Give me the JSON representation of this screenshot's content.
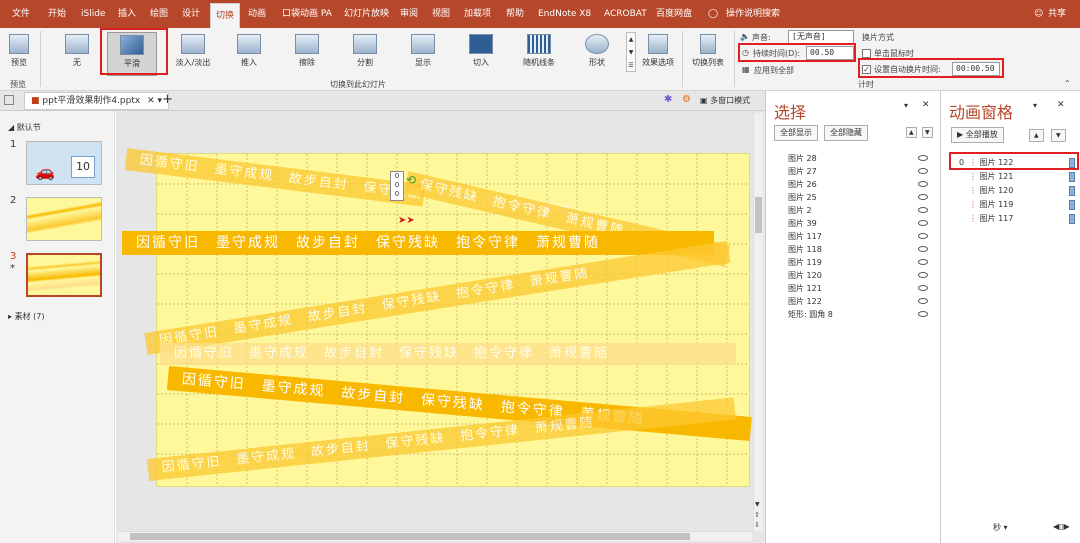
{
  "menu": {
    "items": [
      "文件",
      "开始",
      "iSlide",
      "插入",
      "绘图",
      "设计",
      "切换",
      "动画",
      "口袋动画 PA",
      "幻灯片放映",
      "审阅",
      "视图",
      "加载项",
      "帮助",
      "EndNote X8",
      "ACROBAT",
      "百度网盘"
    ],
    "active": "切换",
    "search": "操作说明搜索",
    "share": "共享"
  },
  "ribbon": {
    "preview_label": "预览",
    "preview_group": "预览",
    "transitions": [
      "无",
      "平滑",
      "淡入/淡出",
      "推入",
      "擦除",
      "分割",
      "显示",
      "切入",
      "随机线条",
      "形状"
    ],
    "selected_transition": "平滑",
    "effect_options": "效果选项",
    "group_label": "切换到此幻灯片",
    "switch_list": "切换列表",
    "sound_label": "声音:",
    "sound_value": "[无声音]",
    "duration_label": "持续时间(D):",
    "duration_value": "00.50",
    "apply_all": "应用到全部",
    "advance_title": "换片方式",
    "on_click": "单击鼠标时",
    "auto_advance": "设置自动换片时间:",
    "auto_value": "00:00.50",
    "timing_group": "计时"
  },
  "doc_tab": {
    "filename": "ppt平滑效果制作4.pptx",
    "multi_window": "多窗口模式"
  },
  "thumbs": {
    "section_default": "默认节",
    "section_material": "素材 (7)",
    "slide_numbers": [
      "1",
      "2",
      "3"
    ],
    "star": "*",
    "calendar_day": "10"
  },
  "slide": {
    "band_text": "因循守旧　墨守成规　故步自封　保守残缺　抱令守律　萧规曹随",
    "markers": [
      "0",
      "0",
      "0"
    ]
  },
  "colors": {
    "accent": "#b7472a",
    "band_dark": "#f9b800",
    "band_mid": "#fcc830",
    "band_light": "#fde08a"
  },
  "selection_pane": {
    "title": "选择",
    "show_all": "全部显示",
    "hide_all": "全部隐藏",
    "items": [
      "图片 28",
      "图片 27",
      "图片 26",
      "图片 25",
      "图片 2",
      "图片 39",
      "图片 117",
      "图片 118",
      "图片 119",
      "图片 120",
      "图片 121",
      "图片 122",
      "矩形: 圆角 8"
    ]
  },
  "animation_pane": {
    "title": "动画窗格",
    "play_all": "全部播放",
    "first_index": "0",
    "items": [
      "图片 122",
      "图片 121",
      "图片 120",
      "图片 119",
      "图片 117"
    ],
    "seconds": "秒"
  }
}
